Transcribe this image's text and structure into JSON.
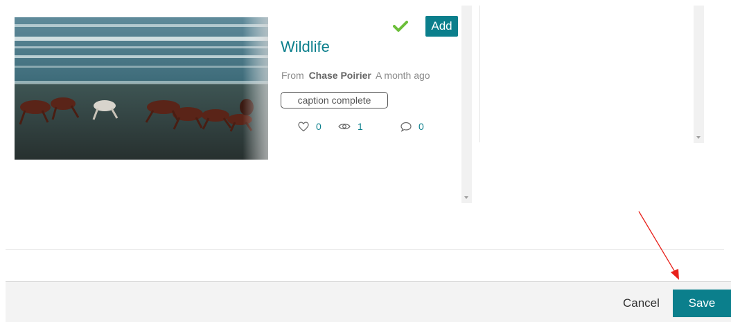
{
  "media": {
    "title": "Wildlife",
    "from_label": "From",
    "author": "Chase Poirier",
    "time_ago": "A month ago",
    "badge": "caption complete",
    "likes": "0",
    "views": "1",
    "comments": "0",
    "add_label": "Add"
  },
  "footer": {
    "cancel_label": "Cancel",
    "save_label": "Save"
  },
  "colors": {
    "accent": "#0b7f8c",
    "check": "#6cbf3a",
    "annotation": "#e8201a"
  },
  "icons": [
    "check-icon",
    "heart-icon",
    "eye-icon",
    "comment-icon",
    "scroll-down-icon"
  ]
}
